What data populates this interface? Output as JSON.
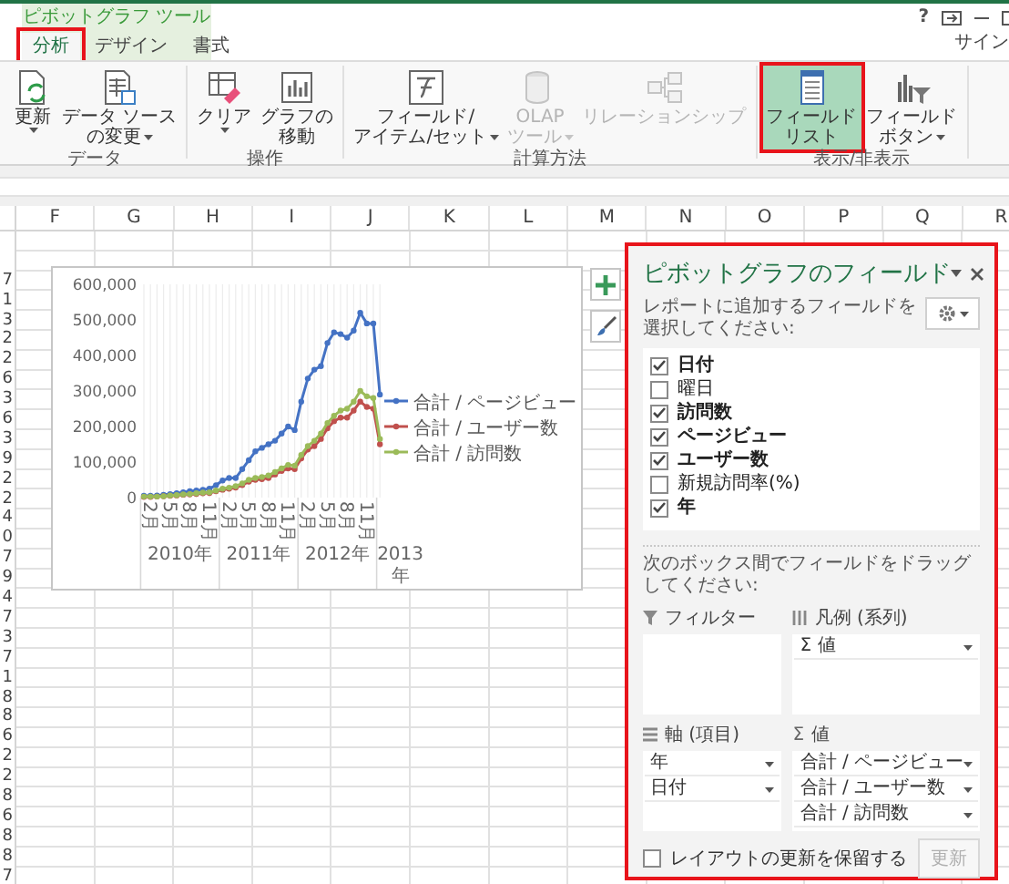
{
  "window": {
    "context_title": "ピボットグラフ ツール",
    "help": "?",
    "account": "サイン"
  },
  "tabs": [
    {
      "label": "分析",
      "selected": true,
      "highlighted": true
    },
    {
      "label": "デザイン",
      "selected": false,
      "highlighted": false
    },
    {
      "label": "書式",
      "selected": false,
      "highlighted": false
    }
  ],
  "ribbon_groups": [
    {
      "label": "データ",
      "buttons": [
        {
          "kind": "refresh",
          "lines": [
            "更新"
          ],
          "dropdown": true,
          "disabled": false,
          "selected": false,
          "highlighted": false
        },
        {
          "kind": "data_source",
          "lines": [
            "データ ソース",
            "の変更"
          ],
          "dropdown": true,
          "disabled": false,
          "selected": false,
          "highlighted": false
        }
      ]
    },
    {
      "label": "操作",
      "buttons": [
        {
          "kind": "clear",
          "lines": [
            "クリア"
          ],
          "dropdown": true,
          "disabled": false,
          "selected": false,
          "highlighted": false
        },
        {
          "kind": "move_chart",
          "lines": [
            "グラフの",
            "移動"
          ],
          "dropdown": false,
          "disabled": false,
          "selected": false,
          "highlighted": false
        }
      ]
    },
    {
      "label": "計算方法",
      "buttons": [
        {
          "kind": "fields_items",
          "lines": [
            "フィールド/",
            "アイテム/セット"
          ],
          "dropdown": true,
          "disabled": false,
          "selected": false,
          "highlighted": false
        },
        {
          "kind": "olap",
          "lines": [
            "OLAP",
            "ツール"
          ],
          "dropdown": true,
          "disabled": true,
          "selected": false,
          "highlighted": false
        },
        {
          "kind": "relationships",
          "lines": [
            "リレーションシップ"
          ],
          "dropdown": false,
          "disabled": true,
          "selected": false,
          "highlighted": false
        }
      ]
    },
    {
      "label": "表示/非表示",
      "buttons": [
        {
          "kind": "field_list",
          "lines": [
            "フィールド",
            "リスト"
          ],
          "dropdown": false,
          "disabled": false,
          "selected": true,
          "highlighted": true
        },
        {
          "kind": "field_buttons",
          "lines": [
            "フィールド",
            "ボタン"
          ],
          "dropdown": true,
          "disabled": false,
          "selected": false,
          "highlighted": false
        }
      ]
    }
  ],
  "sheet": {
    "columns": [
      "F",
      "G",
      "H",
      "I",
      "J",
      "K",
      "L",
      "M",
      "N",
      "O",
      "P",
      "Q",
      "R"
    ],
    "row_numbers": [
      "7",
      "1",
      "3",
      "2",
      "2",
      "6",
      "3",
      "6",
      "3",
      "9",
      "2",
      "2",
      "4",
      "0",
      "7",
      "9",
      "4",
      "7",
      "3",
      "7",
      "1",
      "8",
      "8",
      "6",
      "2",
      "2",
      "8",
      "6",
      "8",
      "8",
      "7"
    ]
  },
  "chart": {
    "chart_data": {
      "type": "line",
      "categories": [
        null,
        "2月",
        null,
        null,
        "5月",
        null,
        null,
        "8月",
        null,
        null,
        "11月",
        null,
        null,
        "2月",
        null,
        null,
        "5月",
        null,
        null,
        "8月",
        null,
        null,
        "11月",
        null,
        null,
        "2月",
        null,
        null,
        "5月",
        null,
        null,
        "8月",
        null,
        null,
        "11月",
        null,
        null
      ],
      "series": [
        {
          "name": "合計 / ページビュー",
          "color": "#4472c4",
          "values": [
            5000,
            5000,
            6000,
            8000,
            10000,
            12000,
            15000,
            18000,
            20000,
            22000,
            25000,
            35000,
            48000,
            55000,
            55000,
            80000,
            105000,
            130000,
            140000,
            150000,
            160000,
            180000,
            200000,
            190000,
            270000,
            335000,
            360000,
            370000,
            435000,
            465000,
            460000,
            450000,
            470000,
            520000,
            490000,
            490000,
            290000
          ]
        },
        {
          "name": "合計 / ユーザー数",
          "color": "#c0504d",
          "values": [
            2000,
            2000,
            3000,
            4000,
            5000,
            6000,
            8000,
            9000,
            10000,
            12000,
            13000,
            18000,
            22000,
            25000,
            28000,
            35000,
            45000,
            50000,
            52000,
            55000,
            65000,
            75000,
            82000,
            80000,
            110000,
            135000,
            145000,
            165000,
            195000,
            215000,
            225000,
            225000,
            245000,
            270000,
            255000,
            250000,
            150000
          ]
        },
        {
          "name": "合計 / 訪問数",
          "color": "#9bbb59",
          "values": [
            3000,
            3000,
            3000,
            4000,
            6000,
            7000,
            9000,
            10000,
            12000,
            14000,
            15000,
            20000,
            25000,
            28000,
            32000,
            40000,
            50000,
            55000,
            58000,
            62000,
            72000,
            82000,
            92000,
            90000,
            120000,
            145000,
            160000,
            180000,
            210000,
            230000,
            245000,
            250000,
            270000,
            300000,
            285000,
            280000,
            165000
          ]
        }
      ],
      "ylim": [
        0,
        600000
      ],
      "yticks": [
        0,
        {
          "value": 100000,
          "label": "100,000"
        },
        {
          "value": 200000,
          "label": "200,000"
        },
        {
          "value": 300000,
          "label": "300,000"
        },
        {
          "value": 400000,
          "label": "400,000"
        },
        {
          "value": 500000,
          "label": "500,000"
        },
        {
          "value": 600000,
          "label": "600,000"
        }
      ],
      "grid": true,
      "legend": "right",
      "annotations": [
        "2010年",
        "2011年",
        "2012年",
        "2013年"
      ]
    }
  },
  "field_panel": {
    "title": "ピボットグラフのフィールド",
    "highlighted": true,
    "instruction": "レポートに追加するフィールドを選択してください:",
    "fields": [
      {
        "label": "日付",
        "checked": true
      },
      {
        "label": "曜日",
        "checked": false
      },
      {
        "label": "訪問数",
        "checked": true
      },
      {
        "label": "ページビュー",
        "checked": true
      },
      {
        "label": "ユーザー数",
        "checked": true
      },
      {
        "label": "新規訪問率(%)",
        "checked": false
      },
      {
        "label": "年",
        "checked": true
      }
    ],
    "drag_instruction": "次のボックス間でフィールドをドラッグしてください:",
    "areas": [
      {
        "kind": "filter",
        "label": "フィルター"
      },
      {
        "kind": "legend",
        "label": "凡例 (系列)",
        "items": [
          "Σ 値"
        ]
      },
      {
        "kind": "axis",
        "label": "軸 (項目)",
        "items": [
          "年",
          "日付"
        ]
      },
      {
        "kind": "values",
        "symbol": "Σ",
        "label": "値",
        "items": [
          "合計 / ページビュー",
          "合計 / ユーザー数",
          "合計 / 訪問数"
        ]
      }
    ],
    "defer": {
      "label": "レイアウトの更新を保留する",
      "checked": false
    },
    "update_button": {
      "label": "更新",
      "disabled": true
    }
  }
}
